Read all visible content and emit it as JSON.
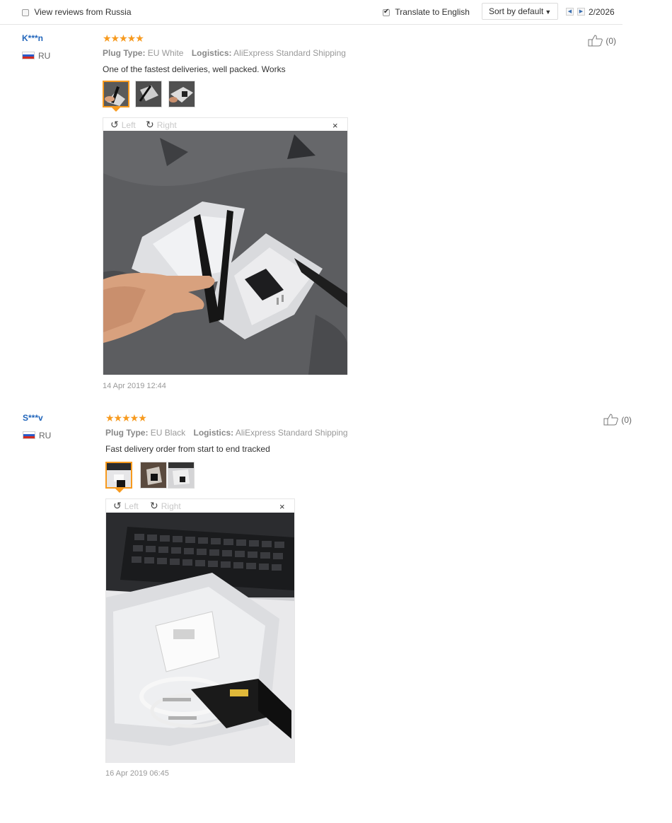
{
  "toolbar": {
    "view_reviews_from": "View reviews from Russia",
    "translate_label": "Translate to English",
    "sort_label": "Sort by default",
    "page_indicator": "2/2026"
  },
  "viewer": {
    "rotate_left": "Left",
    "rotate_right": "Right",
    "close": "×"
  },
  "reviews": [
    {
      "user": "K***n",
      "country": "RU",
      "rating": 5,
      "stars": "★★★★★",
      "plug_type_key": "Plug Type:",
      "plug_type_value": "EU White",
      "logistics_key": "Logistics:",
      "logistics_value": "AliExpress Standard Shipping",
      "text": "One of the fastest deliveries, well packed. Works",
      "date": "14 Apr 2019 12:44",
      "likes": "(0)"
    },
    {
      "user": "S***v",
      "country": "RU",
      "rating": 5,
      "stars": "★★★★★",
      "plug_type_key": "Plug Type:",
      "plug_type_value": "EU Black",
      "logistics_key": "Logistics:",
      "logistics_value": "AliExpress Standard Shipping",
      "text": "Fast delivery order from start to end tracked",
      "date": "16 Apr 2019 06:45",
      "likes": "(0)"
    }
  ],
  "colors": {
    "accent": "#f79a1e",
    "link": "#2266bb",
    "muted": "#999999"
  }
}
